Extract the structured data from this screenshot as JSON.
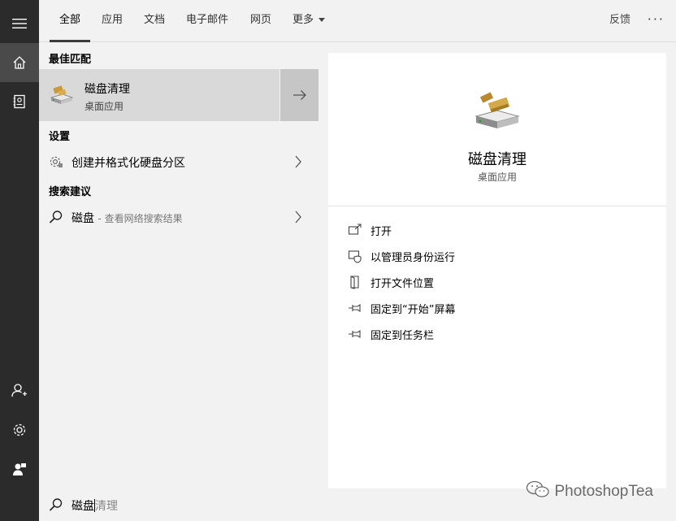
{
  "tabs": [
    {
      "label": "全部",
      "active": true
    },
    {
      "label": "应用"
    },
    {
      "label": "文档"
    },
    {
      "label": "电子邮件"
    },
    {
      "label": "网页"
    },
    {
      "label": "更多"
    }
  ],
  "header": {
    "feedback": "反馈",
    "more": "···"
  },
  "rail": {
    "items": [
      "hamburger-icon",
      "home-icon",
      "notebook-icon",
      "account-icon",
      "gear-icon",
      "feedback-person-icon"
    ]
  },
  "results": {
    "best_match_title": "最佳匹配",
    "best_match": {
      "name": "磁盘清理",
      "type": "桌面应用",
      "icon": "disk-cleanup-icon"
    },
    "settings_title": "设置",
    "settings_item": {
      "label": "创建并格式化硬盘分区",
      "icon": "settings-gear-icon"
    },
    "suggest_title": "搜索建议",
    "suggest_item": {
      "query": "磁盘",
      "hint": "- 查看网络搜索结果",
      "icon": "search-icon"
    }
  },
  "preview": {
    "name": "磁盘清理",
    "type": "桌面应用",
    "actions": [
      {
        "label": "打开",
        "icon": "open-icon"
      },
      {
        "label": "以管理员身份运行",
        "icon": "shield-icon"
      },
      {
        "label": "打开文件位置",
        "icon": "file-location-icon"
      },
      {
        "label": "固定到“开始”屏幕",
        "icon": "pin-icon"
      },
      {
        "label": "固定到任务栏",
        "icon": "pin-icon"
      }
    ]
  },
  "search": {
    "typed": "磁盘",
    "suggestion": "清理"
  },
  "watermark": "PhotoshopTea",
  "colors": {
    "rail": "#2b2b2b",
    "selected": "#d9d9d9",
    "background": "#f2f2f2"
  }
}
